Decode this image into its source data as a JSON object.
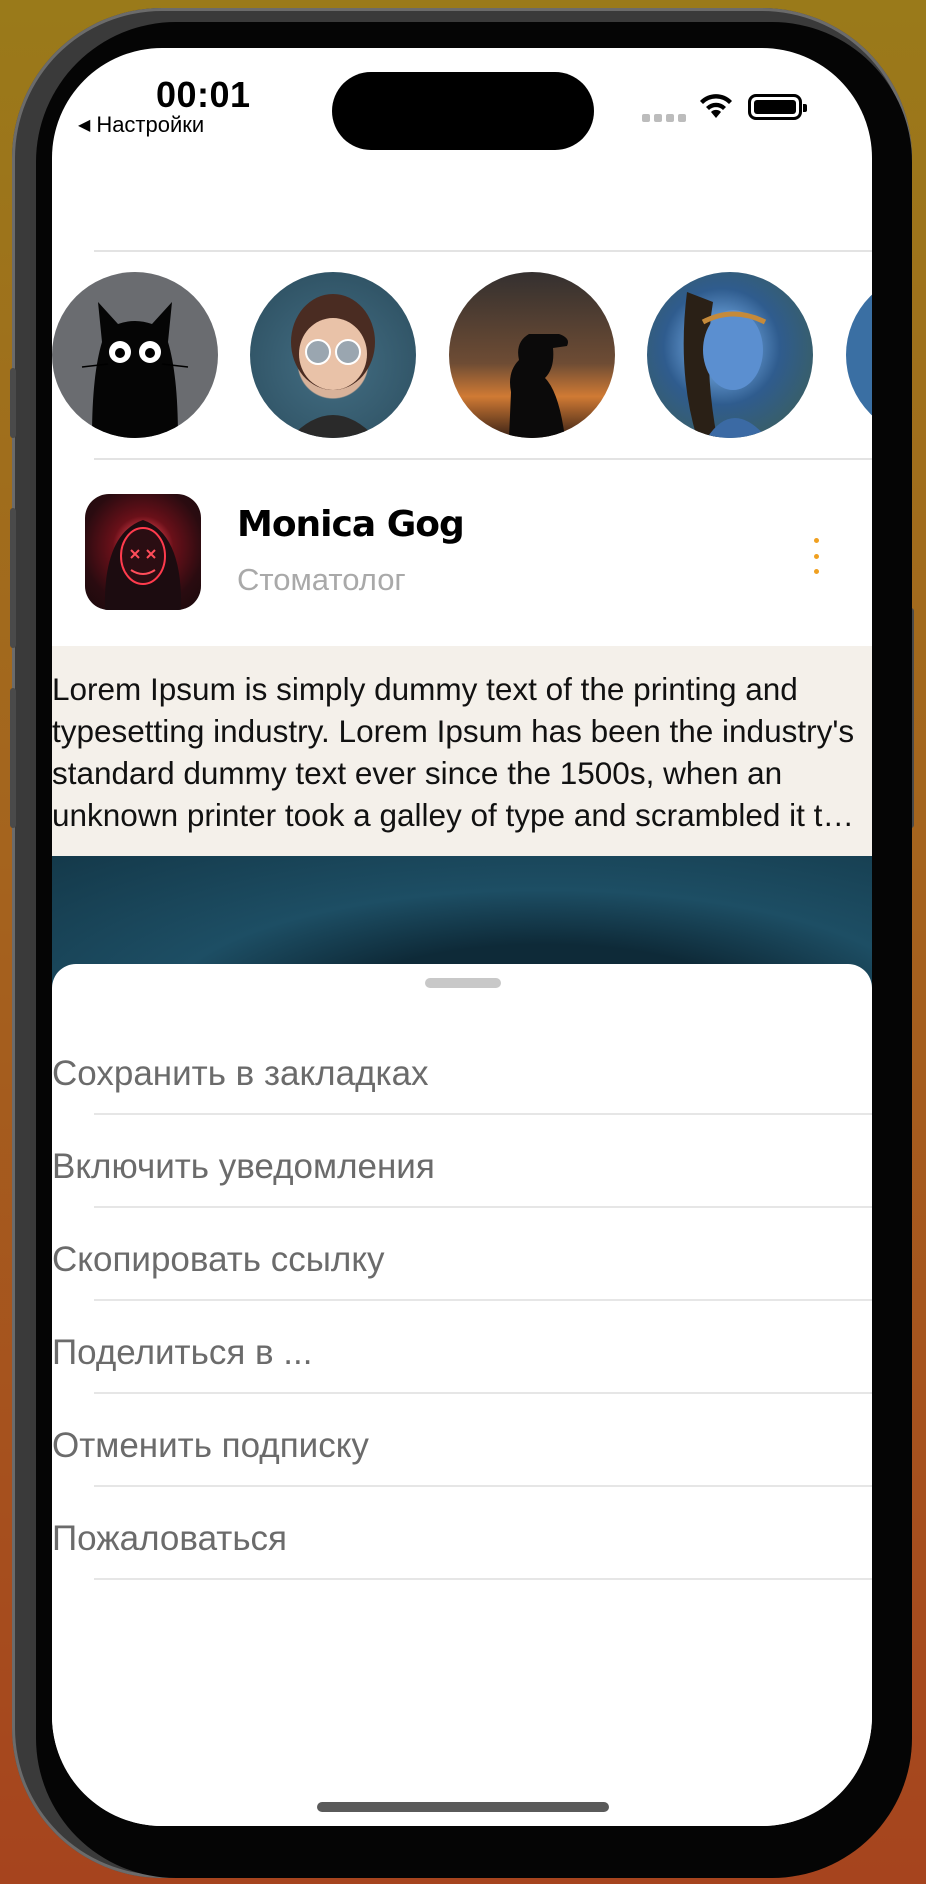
{
  "status_bar": {
    "time": "00:01",
    "back_label": "Настройки"
  },
  "stories": [
    {
      "name": "story-cat",
      "color": "#6a6c70"
    },
    {
      "name": "story-girl-glasses",
      "color": "#3c6478"
    },
    {
      "name": "story-silhouette-sunset",
      "color": "#6e4c34"
    },
    {
      "name": "story-avatar-navi",
      "color": "#2f5c8e"
    },
    {
      "name": "story-partial",
      "color": "#3a6fa3"
    }
  ],
  "profile": {
    "name": "Monica Gog",
    "role": "Стоматолог",
    "accent_color": "#f0a020"
  },
  "post": {
    "text": "Lorem Ipsum is simply dummy text of the printing and typesetting industry. Lorem Ipsum has been the industry's standard dummy text ever since the 1500s, when an unknown printer took a galley of type and scrambled it to make a type specimen book."
  },
  "sheet": {
    "items": [
      {
        "label": "Сохранить в закладках"
      },
      {
        "label": "Включить уведомления"
      },
      {
        "label": "Скопировать ссылку"
      },
      {
        "label": "Поделиться в ..."
      },
      {
        "label": "Отменить подписку"
      },
      {
        "label": "Пожаловаться"
      }
    ]
  }
}
